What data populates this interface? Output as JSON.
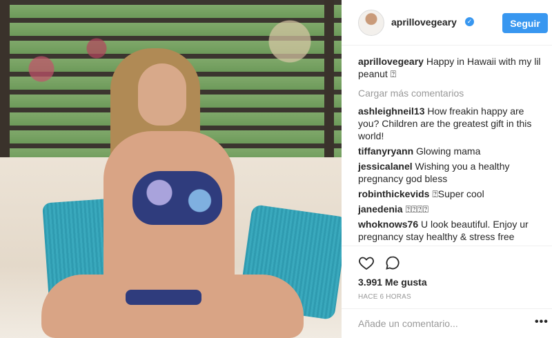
{
  "post": {
    "author": "aprillovegeary",
    "verified_icon": "verified-badge-icon",
    "follow_label": "Seguir",
    "caption_text": "Happy in Hawaii with my lil peanut ⍰"
  },
  "comments": {
    "load_more": "Cargar más comentarios",
    "items": [
      {
        "user": "ashleighneil13",
        "text": "How freakin happy are you? Children are the greatest gift in this world!"
      },
      {
        "user": "tiffanyryann",
        "text": "Glowing mama"
      },
      {
        "user": "jessicalanel",
        "text": "Wishing you a healthy pregnancy god bless"
      },
      {
        "user": "robinthickevids",
        "text": "⍰Super cool"
      },
      {
        "user": "janedenia",
        "text": "⍰⍰⍰⍰"
      },
      {
        "user": "whoknows76",
        "text": "U look beautiful. Enjoy ur pregnancy stay healthy & stress free"
      }
    ]
  },
  "actions": {
    "like_icon": "heart-icon",
    "comment_icon": "comment-icon",
    "likes_text": "3.991 Me gusta",
    "time_text": "HACE 6 HORAS"
  },
  "add_comment": {
    "placeholder": "Añade un comentario...",
    "more_label": "•••"
  },
  "colors": {
    "accent": "#3897f0",
    "muted": "#999999",
    "text": "#262626"
  }
}
